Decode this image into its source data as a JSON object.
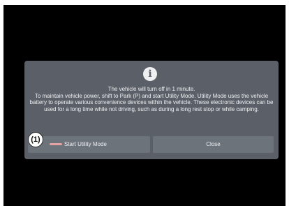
{
  "dialog": {
    "icon": "info-icon",
    "icon_glyph": "i",
    "message_line1": "The vehicle will turn off in 1 minute.",
    "message_line2": "To maintain vehicle power, shift to Park (P) and start Utility Mode. Utility Mode uses the vehicle battery to operate various convenience devices within the vehicle. These electronic devices can be used for a long time while not driving, such as during a long rest stop or while camping."
  },
  "buttons": {
    "start_label": "Start Utility Mode",
    "close_label": "Close"
  },
  "callout": {
    "label": "(1)"
  },
  "colors": {
    "dialog_bg": "#5b6068",
    "button_bg": "#6d737b",
    "text": "#eef0f2",
    "screen_bg": "#000000",
    "start_indicator": "#e6a0a0"
  }
}
